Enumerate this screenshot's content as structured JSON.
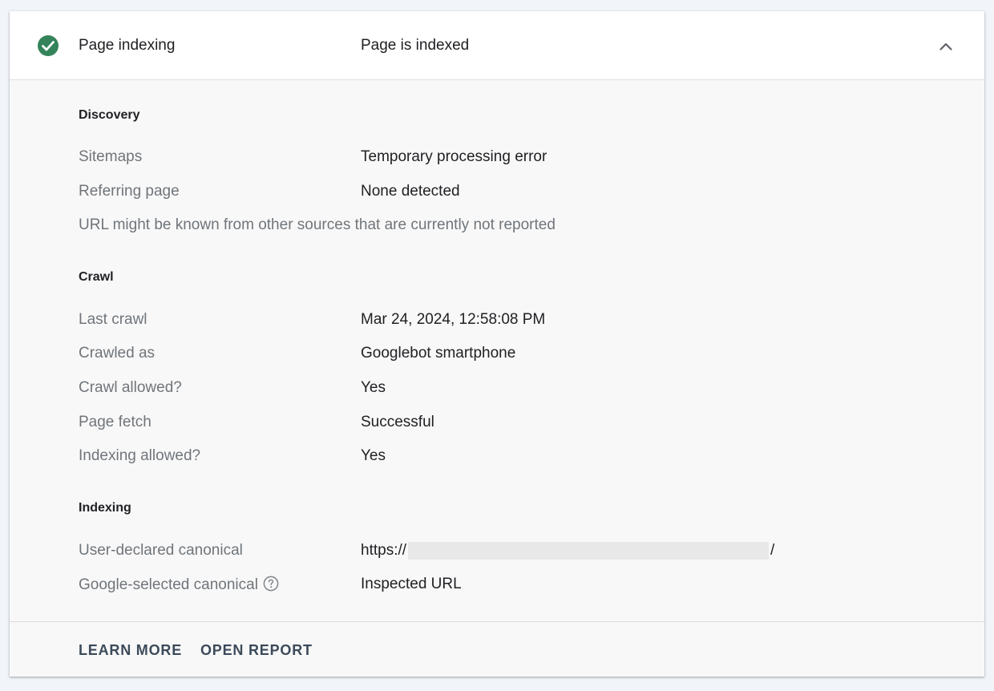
{
  "header": {
    "title": "Page indexing",
    "status": "Page is indexed",
    "status_color": "#34835a"
  },
  "discovery": {
    "title": "Discovery",
    "sitemaps_label": "Sitemaps",
    "sitemaps_value": "Temporary processing error",
    "referring_label": "Referring page",
    "referring_value": "None detected",
    "note": "URL might be known from other sources that are currently not reported"
  },
  "crawl": {
    "title": "Crawl",
    "last_crawl_label": "Last crawl",
    "last_crawl_value": "Mar 24, 2024, 12:58:08 PM",
    "crawled_as_label": "Crawled as",
    "crawled_as_value": "Googlebot smartphone",
    "crawl_allowed_label": "Crawl allowed?",
    "crawl_allowed_value": "Yes",
    "page_fetch_label": "Page fetch",
    "page_fetch_value": "Successful",
    "indexing_allowed_label": "Indexing allowed?",
    "indexing_allowed_value": "Yes"
  },
  "indexing": {
    "title": "Indexing",
    "user_canonical_label": "User-declared canonical",
    "user_canonical_prefix": "https://",
    "user_canonical_suffix": "/",
    "google_canonical_label": "Google-selected canonical",
    "google_canonical_value": "Inspected URL"
  },
  "footer": {
    "learn_more": "LEARN MORE",
    "open_report": "OPEN REPORT"
  },
  "icons": {
    "status": "check-circle-icon",
    "collapse": "chevron-up-icon",
    "help": "help-circle-icon"
  }
}
